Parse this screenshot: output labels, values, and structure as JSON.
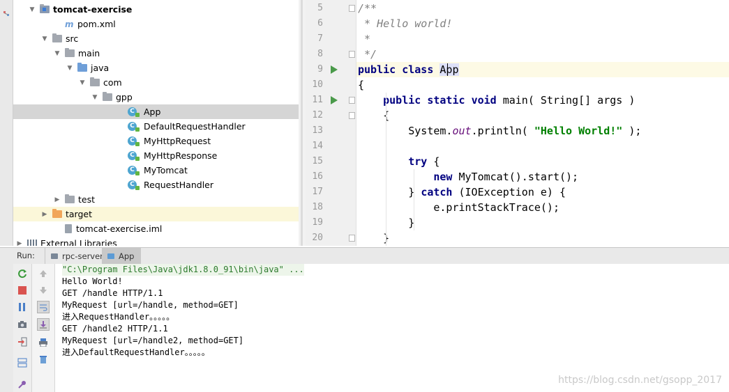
{
  "project_tree": [
    {
      "label": "tomcat-exercise",
      "level": 1,
      "icon": "module-folder-icon",
      "arrow": "down",
      "bold": true
    },
    {
      "label": "pom.xml",
      "level": 3,
      "icon": "maven-icon",
      "arrow": "none"
    },
    {
      "label": "src",
      "level": 2,
      "icon": "folder-icon",
      "arrow": "down"
    },
    {
      "label": "main",
      "level": 3,
      "icon": "folder-icon",
      "arrow": "down"
    },
    {
      "label": "java",
      "level": 4,
      "icon": "source-folder-icon",
      "arrow": "down"
    },
    {
      "label": "com",
      "level": 5,
      "icon": "package-icon",
      "arrow": "down"
    },
    {
      "label": "gpp",
      "level": 6,
      "icon": "package-icon",
      "arrow": "down"
    },
    {
      "label": "App",
      "level": 8,
      "icon": "class-icon",
      "arrow": "none",
      "selected": true
    },
    {
      "label": "DefaultRequestHandler",
      "level": 8,
      "icon": "class-icon",
      "arrow": "none"
    },
    {
      "label": "MyHttpRequest",
      "level": 8,
      "icon": "class-icon",
      "arrow": "none"
    },
    {
      "label": "MyHttpResponse",
      "level": 8,
      "icon": "class-icon",
      "arrow": "none"
    },
    {
      "label": "MyTomcat",
      "level": 8,
      "icon": "class-icon",
      "arrow": "none"
    },
    {
      "label": "RequestHandler",
      "level": 8,
      "icon": "class-icon",
      "arrow": "none"
    },
    {
      "label": "test",
      "level": 3,
      "icon": "folder-icon",
      "arrow": "right"
    },
    {
      "label": "target",
      "level": 2,
      "icon": "excluded-folder-icon",
      "arrow": "right",
      "highlight": true
    },
    {
      "label": "tomcat-exercise.iml",
      "level": 3,
      "icon": "iml-file-icon",
      "arrow": "none"
    },
    {
      "label": "External Libraries",
      "level": 0,
      "icon": "libraries-icon",
      "arrow": "right"
    }
  ],
  "editor": {
    "lines": [
      {
        "num": "5",
        "fold": true,
        "run": false,
        "tokens": [
          {
            "t": "/**",
            "c": "cm"
          }
        ]
      },
      {
        "num": "6",
        "fold": false,
        "run": false,
        "tokens": [
          {
            "t": " * Hello world!",
            "c": "cm"
          }
        ]
      },
      {
        "num": "7",
        "fold": false,
        "run": false,
        "tokens": [
          {
            "t": " *",
            "c": "cm"
          }
        ]
      },
      {
        "num": "8",
        "fold": true,
        "run": false,
        "tokens": [
          {
            "t": " */",
            "c": "cm"
          }
        ]
      },
      {
        "num": "9",
        "fold": false,
        "run": true,
        "caret": true,
        "tokens": [
          {
            "t": "public",
            "c": "kw"
          },
          {
            "t": " "
          },
          {
            "t": "class",
            "c": "kw"
          },
          {
            "t": " "
          },
          {
            "t": "App",
            "c": "hlword"
          }
        ]
      },
      {
        "num": "10",
        "fold": false,
        "run": false,
        "tokens": [
          {
            "t": "{"
          }
        ]
      },
      {
        "num": "11",
        "fold": true,
        "run": true,
        "tokens": [
          {
            "t": "    "
          },
          {
            "t": "public",
            "c": "kw"
          },
          {
            "t": " "
          },
          {
            "t": "static",
            "c": "kw"
          },
          {
            "t": " "
          },
          {
            "t": "void",
            "c": "kw"
          },
          {
            "t": " main( String[] args )"
          }
        ]
      },
      {
        "num": "12",
        "fold": true,
        "run": false,
        "tokens": [
          {
            "t": "    {"
          }
        ]
      },
      {
        "num": "13",
        "fold": false,
        "run": false,
        "tokens": [
          {
            "t": "        System."
          },
          {
            "t": "out",
            "c": "fld"
          },
          {
            "t": ".println( "
          },
          {
            "t": "\"Hello World!\"",
            "c": "st"
          },
          {
            "t": " );"
          }
        ]
      },
      {
        "num": "14",
        "fold": false,
        "run": false,
        "tokens": [
          {
            "t": ""
          }
        ]
      },
      {
        "num": "15",
        "fold": false,
        "run": false,
        "tokens": [
          {
            "t": "        "
          },
          {
            "t": "try",
            "c": "kw"
          },
          {
            "t": " {"
          }
        ]
      },
      {
        "num": "16",
        "fold": false,
        "run": false,
        "tokens": [
          {
            "t": "            "
          },
          {
            "t": "new",
            "c": "kw"
          },
          {
            "t": " MyTomcat().start();"
          }
        ]
      },
      {
        "num": "17",
        "fold": false,
        "run": false,
        "tokens": [
          {
            "t": "        } "
          },
          {
            "t": "catch",
            "c": "kw"
          },
          {
            "t": " (IOException e) {"
          }
        ]
      },
      {
        "num": "18",
        "fold": false,
        "run": false,
        "tokens": [
          {
            "t": "            e.printStackTrace();"
          }
        ]
      },
      {
        "num": "19",
        "fold": false,
        "run": false,
        "tokens": [
          {
            "t": "        }"
          }
        ]
      },
      {
        "num": "20",
        "fold": true,
        "run": false,
        "tokens": [
          {
            "t": "    }"
          }
        ]
      }
    ]
  },
  "run_panel": {
    "label": "Run:",
    "tabs": [
      {
        "label": "rpc-server",
        "active": false
      },
      {
        "label": "App",
        "active": true
      }
    ],
    "console_lines": [
      {
        "text": "\"C:\\Program Files\\Java\\jdk1.8.0_91\\bin\\java\" ...",
        "cmd": true
      },
      {
        "text": "Hello World!"
      },
      {
        "text": "GET /handle HTTP/1.1"
      },
      {
        "text": "MyRequest [url=/handle, method=GET]"
      },
      {
        "text": "进入RequestHandler。。。。。"
      },
      {
        "text": "GET /handle2 HTTP/1.1"
      },
      {
        "text": "MyRequest [url=/handle2, method=GET]"
      },
      {
        "text": "进入DefaultRequestHandler。。。。。"
      }
    ],
    "toolbar_icons": [
      "rerun-icon",
      "stop-icon",
      "pause-icon",
      "camera-icon",
      "exit-icon",
      "layout-icon",
      "pin-icon"
    ],
    "toolbar2_icons": [
      "up-arrow-icon",
      "down-arrow-icon",
      "soft-wrap-icon",
      "scroll-to-end-icon",
      "print-icon",
      "trash-icon"
    ]
  },
  "watermark": "https://blog.csdn.net/gsopp_2017",
  "colors": {
    "keyword": "#000080",
    "string": "#008000",
    "comment": "#808080",
    "selection": "#d5d5d5",
    "run_arrow": "#4a9a4a"
  }
}
